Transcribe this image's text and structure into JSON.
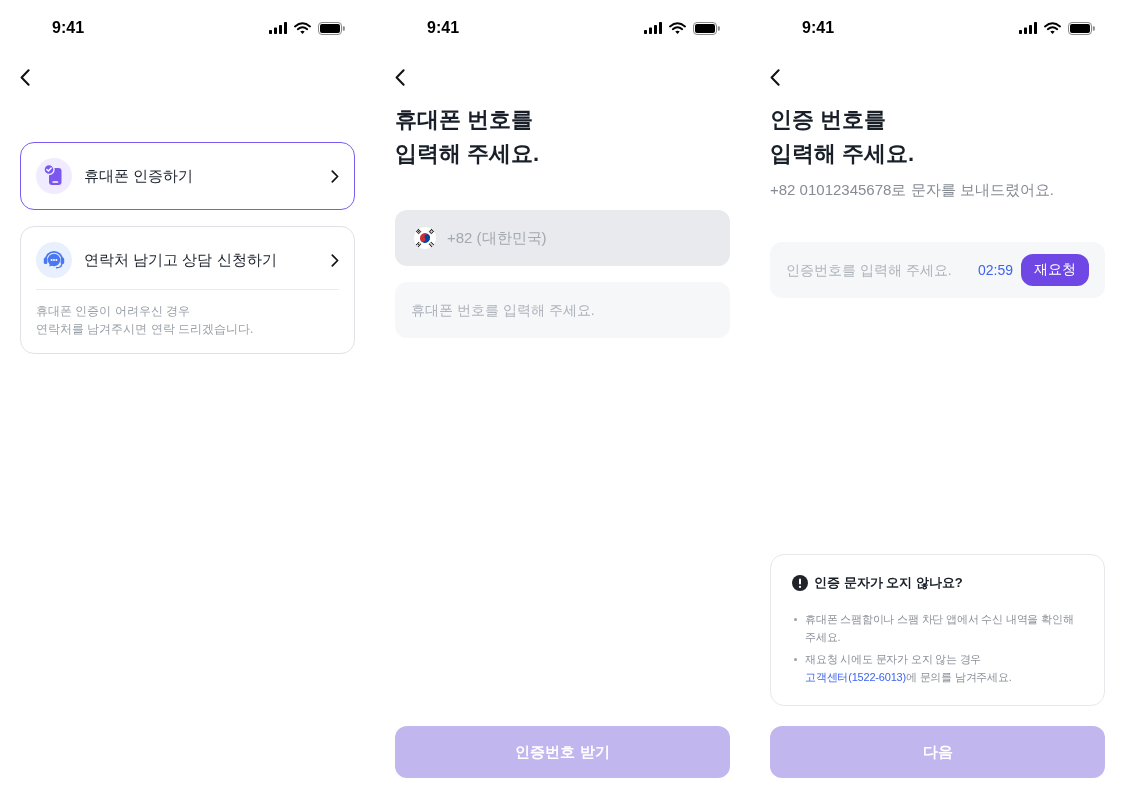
{
  "screens": [
    {
      "kind": "method",
      "status_bar": {
        "time": "9:41"
      },
      "options": [
        {
          "label": "휴대폰 인증하기",
          "selected": true
        },
        {
          "label": "연락처 남기고 상담 신청하기",
          "selected": false,
          "description": [
            "휴대폰 인증이 어려우신 경우",
            "연락처를 남겨주시면 연락 드리겠습니다."
          ]
        }
      ]
    },
    {
      "kind": "phone",
      "status_bar": {
        "time": "9:41"
      },
      "title": [
        "휴대폰 번호를",
        "입력해 주세요."
      ],
      "country_field": {
        "value": "+82 (대한민국)",
        "disabled": true
      },
      "phone_field": {
        "placeholder": "휴대폰 번호를 입력해 주세요."
      },
      "submit_button": {
        "label": "인증번호 받기",
        "disabled": true
      }
    },
    {
      "kind": "code",
      "status_bar": {
        "time": "9:41"
      },
      "title": [
        "인증 번호를",
        "입력해 주세요."
      ],
      "subtitle": "+82 01012345678로 문자를 보내드렸어요.",
      "code_field": {
        "placeholder": "인증번호를 입력해 주세요.",
        "timer": "02:59",
        "resend_button": "재요청"
      },
      "help_box": {
        "title": "인증 문자가 오지 않나요?",
        "items": [
          {
            "text": "휴대폰 스팸함이나 스팸 차단 앱에서 수신 내역을 확인해 주세요."
          },
          {
            "text": "재요청 시에도 문자가 오지 않는 경우",
            "link": "고객센터(1522-6013)",
            "after": "에 문의를 남겨주세요."
          }
        ]
      },
      "submit_button": {
        "label": "다음",
        "disabled": true
      }
    }
  ]
}
